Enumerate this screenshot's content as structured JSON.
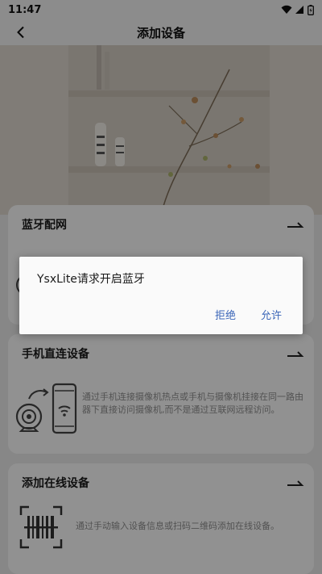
{
  "status_bar": {
    "time": "11:47"
  },
  "nav": {
    "title": "添加设备"
  },
  "cards": {
    "bluetooth": {
      "title": "蓝牙配网"
    },
    "direct": {
      "title": "手机直连设备",
      "description": "通过手机连接摄像机热点或手机与摄像机挂接在同一路由器下直接访问摄像机,而不是通过互联网远程访问。"
    },
    "online": {
      "title": "添加在线设备",
      "description": "通过手动输入设备信息或扫码二维码添加在线设备。"
    }
  },
  "dialog": {
    "message": "YsxLite请求开启蓝牙",
    "deny_label": "拒绝",
    "allow_label": "允许"
  },
  "colors": {
    "accent": "#3b66b8",
    "card_bg": "#fafafa",
    "dim_overlay": "rgba(0,0,0,0.42)"
  }
}
